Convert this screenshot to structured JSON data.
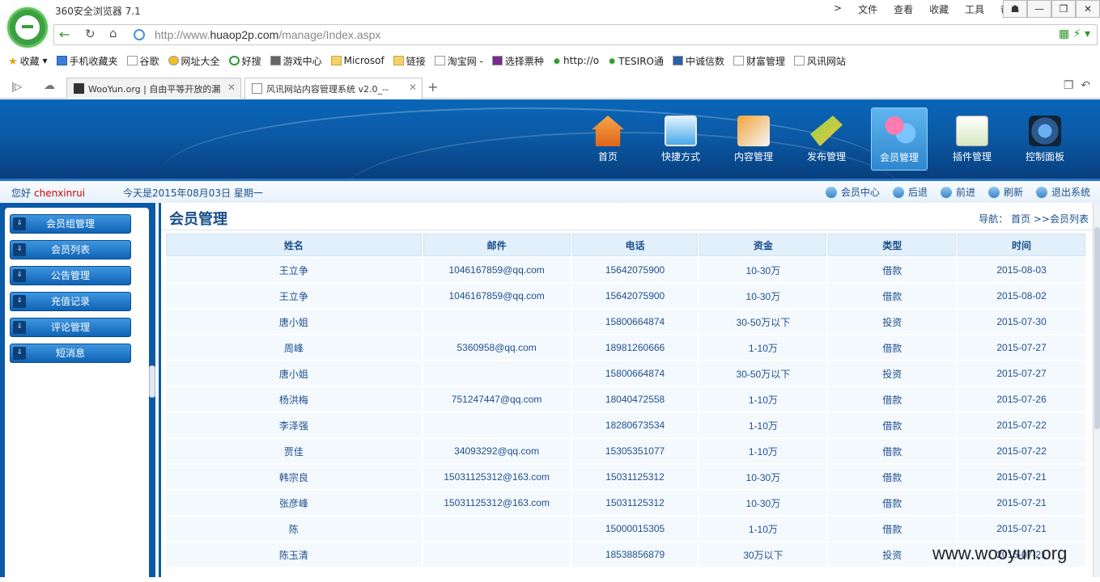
{
  "browser": {
    "title": "360安全浏览器 7.1",
    "menu": [
      ">",
      "文件",
      "查看",
      "收藏",
      "工具",
      "帮助"
    ],
    "window_controls": [
      "☗",
      "—",
      "❐",
      "✕"
    ],
    "url_prefix": "http://www.",
    "url_domain": "huaop2p.com",
    "url_path": "/manage/Index.aspx",
    "bookmarks": [
      "收藏",
      "手机收藏夹",
      "谷歌",
      "网址大全",
      "好搜",
      "游戏中心",
      "Microsof",
      "链接",
      "淘宝网 -",
      "选择票种",
      "http://o",
      "TESIRO通",
      "中诚信数",
      "财富管理",
      "风讯网站"
    ],
    "tabs": [
      {
        "title": "WooYun.org | 自由平等开放的漏"
      },
      {
        "title": "风讯网站内容管理系统 v2.0_--"
      }
    ]
  },
  "top_nav": [
    {
      "label": "首页",
      "icon": "home-icon"
    },
    {
      "label": "快捷方式",
      "icon": "monitor-icon"
    },
    {
      "label": "内容管理",
      "icon": "content-icon"
    },
    {
      "label": "发布管理",
      "icon": "publish-icon"
    },
    {
      "label": "会员管理",
      "icon": "members-icon",
      "active": true
    },
    {
      "label": "插件管理",
      "icon": "plugin-icon"
    },
    {
      "label": "控制面板",
      "icon": "control-panel-icon"
    }
  ],
  "info": {
    "greeting": "您好",
    "username": "chenxinrui",
    "today": "今天是2015年08月03日 星期一",
    "links": [
      "会员中心",
      "后退",
      "前进",
      "刷新",
      "退出系统"
    ]
  },
  "sidebar": {
    "items": [
      "会员组管理",
      "会员列表",
      "公告管理",
      "充值记录",
      "评论管理",
      "短消息"
    ]
  },
  "main": {
    "title": "会员管理",
    "breadcrumb": "导航： 首页 >>会员列表",
    "columns": [
      "姓名",
      "邮件",
      "电话",
      "资金",
      "类型",
      "时间"
    ],
    "rows": [
      [
        "王立争",
        "1046167859@qq.com",
        "15642075900",
        "10-30万",
        "借款",
        "2015-08-03"
      ],
      [
        "王立争",
        "1046167859@qq.com",
        "15642075900",
        "10-30万",
        "借款",
        "2015-08-02"
      ],
      [
        "唐小姐",
        "",
        "15800664874",
        "30-50万以下",
        "投资",
        "2015-07-30"
      ],
      [
        "周峰",
        "5360958@qq.com",
        "18981260666",
        "1-10万",
        "借款",
        "2015-07-27"
      ],
      [
        "唐小姐",
        "",
        "15800664874",
        "30-50万以下",
        "投资",
        "2015-07-27"
      ],
      [
        "杨洪梅",
        "751247447@qq.com",
        "18040472558",
        "1-10万",
        "借款",
        "2015-07-26"
      ],
      [
        "李泽强",
        "",
        "18280673534",
        "1-10万",
        "借款",
        "2015-07-22"
      ],
      [
        "贾佳",
        "34093292@qq.com",
        "15305351077",
        "1-10万",
        "借款",
        "2015-07-22"
      ],
      [
        "韩宗良",
        "15031125312@163.com",
        "15031125312",
        "10-30万",
        "借款",
        "2015-07-21"
      ],
      [
        "张彦峰",
        "15031125312@163.com",
        "15031125312",
        "10-30万",
        "借款",
        "2015-07-21"
      ],
      [
        "陈",
        "",
        "15000015305",
        "1-10万",
        "借款",
        "2015-07-21"
      ],
      [
        "陈玉清",
        "",
        "18538856879",
        "30万以下",
        "投资",
        "2015-07-21"
      ]
    ]
  },
  "watermark": "www.wooyun.org"
}
